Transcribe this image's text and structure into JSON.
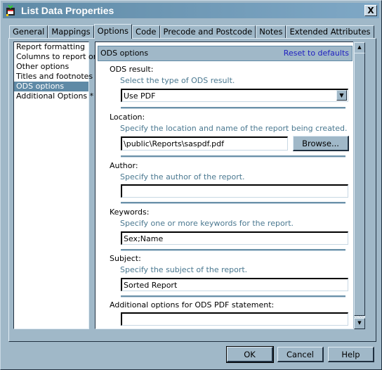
{
  "window": {
    "title": "List Data Properties",
    "close_label": "X"
  },
  "tabs": [
    {
      "label": "General",
      "active": false
    },
    {
      "label": "Mappings",
      "active": false
    },
    {
      "label": "Options",
      "active": true
    },
    {
      "label": "Code",
      "active": false
    },
    {
      "label": "Precode and Postcode",
      "active": false
    },
    {
      "label": "Notes",
      "active": false
    },
    {
      "label": "Extended Attributes",
      "active": false
    }
  ],
  "nav": {
    "items": [
      {
        "label": "Report formatting",
        "selected": false
      },
      {
        "label": "Columns to report on",
        "selected": false
      },
      {
        "label": "Other options",
        "selected": false
      },
      {
        "label": "Titles and footnotes",
        "selected": false
      },
      {
        "label": "ODS options",
        "selected": true
      },
      {
        "label": "Additional Options *",
        "selected": false
      }
    ]
  },
  "section": {
    "title": "ODS options",
    "reset_label": "Reset to defaults"
  },
  "fields": {
    "ods_result": {
      "label": "ODS result:",
      "hint": "Select the type of ODS result.",
      "value": "Use PDF"
    },
    "location": {
      "label": "Location:",
      "hint": "Specify the location and name of the report being created.",
      "value": "\\public\\Reports\\saspdf.pdf",
      "browse_label": "Browse..."
    },
    "author": {
      "label": "Author:",
      "hint": "Specify the author of the report.",
      "value": ""
    },
    "keywords": {
      "label": "Keywords:",
      "hint": "Specify one or more keywords for the report.",
      "value": "Sex;Name"
    },
    "subject": {
      "label": "Subject:",
      "hint": "Specify the subject of the report.",
      "value": "Sorted Report"
    },
    "additional": {
      "label": "Additional options for ODS PDF statement:",
      "value": ""
    }
  },
  "buttons": {
    "ok": "OK",
    "cancel": "Cancel",
    "help": "Help"
  },
  "icons": {
    "app": "list-data-icon",
    "close": "close-icon",
    "dropdown": "chevron-down-icon",
    "scroll_up": "scroll-up-arrow-icon",
    "scroll_down": "scroll-down-arrow-icon"
  }
}
